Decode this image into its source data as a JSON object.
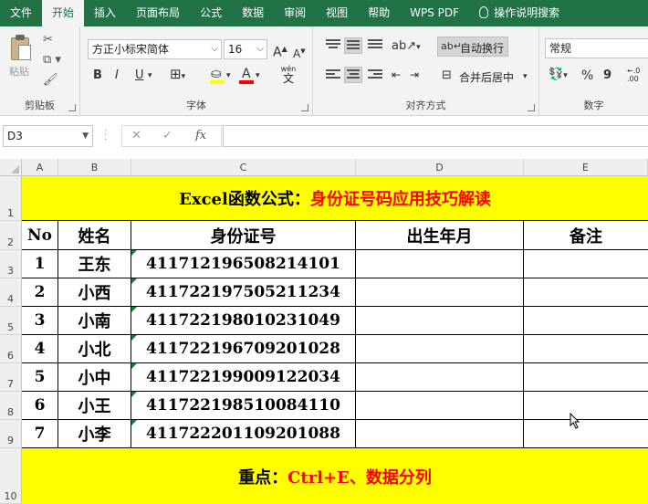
{
  "tabs": [
    "文件",
    "开始",
    "插入",
    "页面布局",
    "公式",
    "数据",
    "审阅",
    "视图",
    "帮助",
    "WPS PDF",
    "操作说明搜索"
  ],
  "active_tab": "开始",
  "ribbon": {
    "clipboard": {
      "paste_label": "粘贴",
      "group_label": "剪贴板"
    },
    "font": {
      "font_name": "方正小标宋简体",
      "font_size": "16",
      "bold": "B",
      "italic": "I",
      "underline": "U",
      "pinyin": "wén",
      "pinyin_sub": "文",
      "font_color_letter": "A",
      "grow_label": "A",
      "shrink_label": "A",
      "group_label": "字体"
    },
    "alignment": {
      "wrap_text": "自动换行",
      "merge_center": "合并后居中",
      "group_label": "对齐方式"
    },
    "number": {
      "format": "常规",
      "percent": "%",
      "comma": "9",
      "group_label": "数字"
    },
    "colors": {
      "fill": "#ffff00",
      "font": "#ff0000",
      "brand": "#217346"
    }
  },
  "formula_bar": {
    "name_box": "D3",
    "cancel": "✕",
    "enter": "✓",
    "fx": "fx",
    "formula": ""
  },
  "columns": [
    "A",
    "B",
    "C",
    "D",
    "E"
  ],
  "rows": [
    "1",
    "2",
    "3",
    "4",
    "5",
    "6",
    "7",
    "8",
    "9",
    "10"
  ],
  "sheet": {
    "title_black": "Excel函数公式：",
    "title_red": "身份证号码应用技巧解读",
    "headers": [
      "No",
      "姓名",
      "身份证号",
      "出生年月",
      "备注"
    ],
    "records": [
      {
        "no": "1",
        "name": "王东",
        "id": "411712196508214101"
      },
      {
        "no": "2",
        "name": "小西",
        "id": "411722197505211234"
      },
      {
        "no": "3",
        "name": "小南",
        "id": "411722198010231049"
      },
      {
        "no": "4",
        "name": "小北",
        "id": "411722196709201028"
      },
      {
        "no": "5",
        "name": "小中",
        "id": "411722199009122034"
      },
      {
        "no": "6",
        "name": "小王",
        "id": "411722198510084110"
      },
      {
        "no": "7",
        "name": "小李",
        "id": "411722201109201088"
      }
    ],
    "footer_black": "重点：",
    "footer_red": "Ctrl+E、数据分列"
  }
}
